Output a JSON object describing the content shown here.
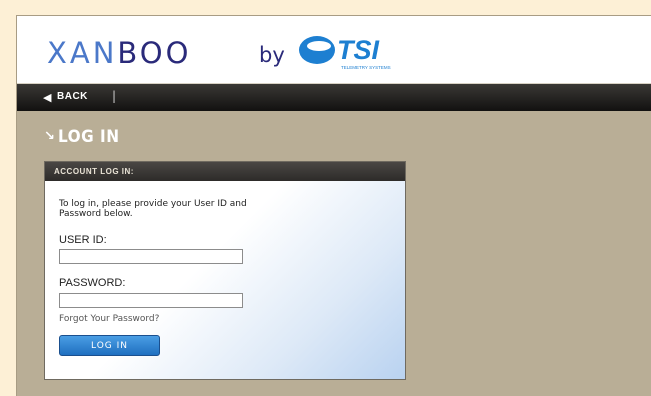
{
  "brand": {
    "xanboo_light": "XAN",
    "xanboo_dark": "BOO",
    "by": "by",
    "tsi": "TSI",
    "tsi_tagline": "TELEMETRY SYSTEMS"
  },
  "nav": {
    "back_label": "BACK",
    "separator": "|"
  },
  "page": {
    "title": "LOG IN"
  },
  "login_panel": {
    "header": "ACCOUNT LOG IN:",
    "instructions": "To log in, please provide your User ID and Password below.",
    "user_id_label": "USER ID:",
    "user_id_value": "",
    "password_label": "PASSWORD:",
    "password_value": "",
    "forgot_link": "Forgot Your Password?",
    "submit_label": "LOG IN"
  },
  "colors": {
    "page_background": "#fdf0d6",
    "frame_background": "#b9ae96",
    "brand_navy": "#2a2a7a",
    "brand_blue": "#4b78c9",
    "tsi_blue": "#1d7fd1",
    "button_blue": "#1f6fc0"
  }
}
